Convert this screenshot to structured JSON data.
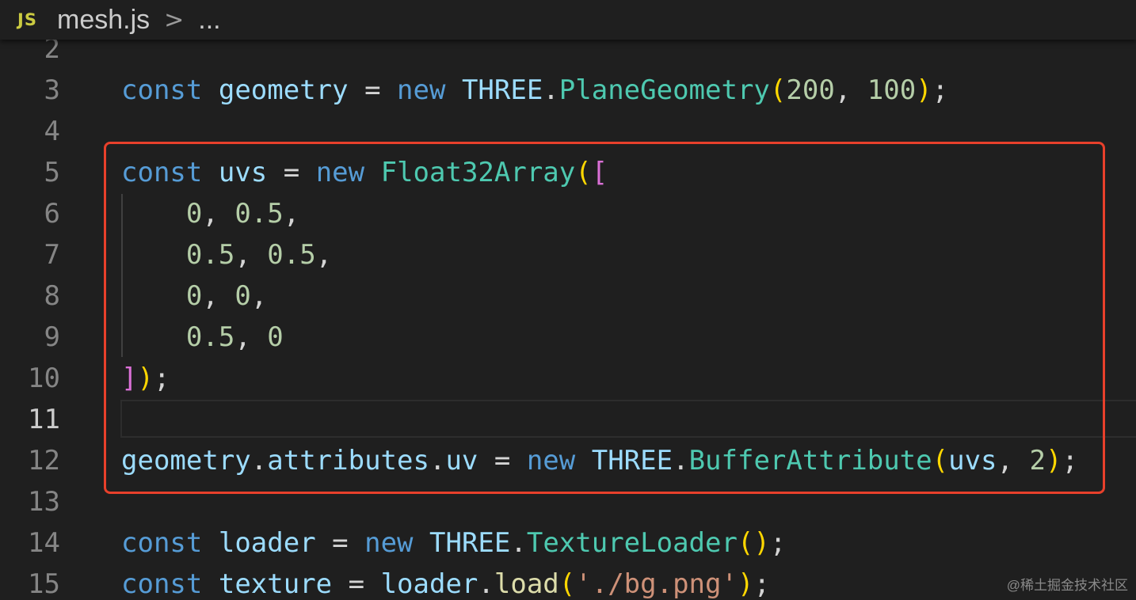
{
  "breadcrumb": {
    "icon_label": "JS",
    "file": "mesh.js",
    "separator": ">",
    "more": "..."
  },
  "lines": [
    {
      "num": "2",
      "tokens": []
    },
    {
      "num": "3",
      "tokens": [
        {
          "t": "kw",
          "v": "const"
        },
        {
          "t": "op",
          "v": " "
        },
        {
          "t": "var",
          "v": "geometry"
        },
        {
          "t": "op",
          "v": " = "
        },
        {
          "t": "kw",
          "v": "new"
        },
        {
          "t": "op",
          "v": " "
        },
        {
          "t": "var",
          "v": "THREE"
        },
        {
          "t": "op",
          "v": "."
        },
        {
          "t": "cls",
          "v": "PlaneGeometry"
        },
        {
          "t": "p1",
          "v": "("
        },
        {
          "t": "num",
          "v": "200"
        },
        {
          "t": "op",
          "v": ", "
        },
        {
          "t": "num",
          "v": "100"
        },
        {
          "t": "p1",
          "v": ")"
        },
        {
          "t": "op",
          "v": ";"
        }
      ]
    },
    {
      "num": "4",
      "tokens": []
    },
    {
      "num": "5",
      "tokens": [
        {
          "t": "kw",
          "v": "const"
        },
        {
          "t": "op",
          "v": " "
        },
        {
          "t": "var",
          "v": "uvs"
        },
        {
          "t": "op",
          "v": " = "
        },
        {
          "t": "kw",
          "v": "new"
        },
        {
          "t": "op",
          "v": " "
        },
        {
          "t": "cls",
          "v": "Float32Array"
        },
        {
          "t": "p1",
          "v": "("
        },
        {
          "t": "p2",
          "v": "["
        }
      ]
    },
    {
      "num": "6",
      "tokens": [
        {
          "t": "op",
          "v": "    "
        },
        {
          "t": "num",
          "v": "0"
        },
        {
          "t": "op",
          "v": ", "
        },
        {
          "t": "num",
          "v": "0.5"
        },
        {
          "t": "op",
          "v": ","
        }
      ]
    },
    {
      "num": "7",
      "tokens": [
        {
          "t": "op",
          "v": "    "
        },
        {
          "t": "num",
          "v": "0.5"
        },
        {
          "t": "op",
          "v": ", "
        },
        {
          "t": "num",
          "v": "0.5"
        },
        {
          "t": "op",
          "v": ","
        }
      ]
    },
    {
      "num": "8",
      "tokens": [
        {
          "t": "op",
          "v": "    "
        },
        {
          "t": "num",
          "v": "0"
        },
        {
          "t": "op",
          "v": ", "
        },
        {
          "t": "num",
          "v": "0"
        },
        {
          "t": "op",
          "v": ","
        }
      ]
    },
    {
      "num": "9",
      "tokens": [
        {
          "t": "op",
          "v": "    "
        },
        {
          "t": "num",
          "v": "0.5"
        },
        {
          "t": "op",
          "v": ", "
        },
        {
          "t": "num",
          "v": "0"
        }
      ]
    },
    {
      "num": "10",
      "tokens": [
        {
          "t": "p2",
          "v": "]"
        },
        {
          "t": "p1",
          "v": ")"
        },
        {
          "t": "op",
          "v": ";"
        }
      ]
    },
    {
      "num": "11",
      "active": true,
      "tokens": []
    },
    {
      "num": "12",
      "tokens": [
        {
          "t": "var",
          "v": "geometry"
        },
        {
          "t": "op",
          "v": "."
        },
        {
          "t": "var",
          "v": "attributes"
        },
        {
          "t": "op",
          "v": "."
        },
        {
          "t": "var",
          "v": "uv"
        },
        {
          "t": "op",
          "v": " = "
        },
        {
          "t": "kw",
          "v": "new"
        },
        {
          "t": "op",
          "v": " "
        },
        {
          "t": "var",
          "v": "THREE"
        },
        {
          "t": "op",
          "v": "."
        },
        {
          "t": "cls",
          "v": "BufferAttribute"
        },
        {
          "t": "p1",
          "v": "("
        },
        {
          "t": "var",
          "v": "uvs"
        },
        {
          "t": "op",
          "v": ", "
        },
        {
          "t": "num",
          "v": "2"
        },
        {
          "t": "p1",
          "v": ")"
        },
        {
          "t": "op",
          "v": ";"
        }
      ]
    },
    {
      "num": "13",
      "tokens": []
    },
    {
      "num": "14",
      "tokens": [
        {
          "t": "kw",
          "v": "const"
        },
        {
          "t": "op",
          "v": " "
        },
        {
          "t": "var",
          "v": "loader"
        },
        {
          "t": "op",
          "v": " = "
        },
        {
          "t": "kw",
          "v": "new"
        },
        {
          "t": "op",
          "v": " "
        },
        {
          "t": "var",
          "v": "THREE"
        },
        {
          "t": "op",
          "v": "."
        },
        {
          "t": "cls",
          "v": "TextureLoader"
        },
        {
          "t": "p1",
          "v": "()"
        },
        {
          "t": "op",
          "v": ";"
        }
      ]
    },
    {
      "num": "15",
      "tokens": [
        {
          "t": "kw",
          "v": "const"
        },
        {
          "t": "op",
          "v": " "
        },
        {
          "t": "var",
          "v": "texture"
        },
        {
          "t": "op",
          "v": " = "
        },
        {
          "t": "var",
          "v": "loader"
        },
        {
          "t": "op",
          "v": "."
        },
        {
          "t": "fn",
          "v": "load"
        },
        {
          "t": "p1",
          "v": "("
        },
        {
          "t": "str",
          "v": "'./bg.png'"
        },
        {
          "t": "p1",
          "v": ")"
        },
        {
          "t": "op",
          "v": ";"
        }
      ]
    }
  ],
  "watermark": "@稀土掘金技术社区",
  "colors": {
    "background": "#1f1f1f",
    "highlight_border": "#e8402b",
    "keyword": "#569cd6",
    "variable": "#9cdcfe",
    "class": "#4ec9b0",
    "number": "#b5cea8",
    "string": "#ce9178",
    "function": "#dcdcaa",
    "bracket_level1": "#ffd700",
    "bracket_level2": "#da70d6"
  }
}
